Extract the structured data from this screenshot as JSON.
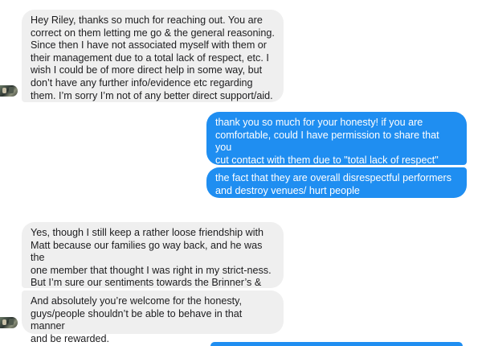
{
  "conversation": {
    "messages": [
      {
        "sender": "contact",
        "text": "Hey Riley, thanks so much for reaching out. You are\ncorrect on them letting me go & the general reasoning.\nSince then I have not associated myself with them or\ntheir management due to a total lack of respect, etc. I\nwish I could be of more direct help in some way, but\ndon’t have any further info/evidence etc regarding\nthem. I’m sorry I’m not of any better direct support/aid."
      },
      {
        "sender": "me",
        "text": "thank you so much for your honesty! if you are\ncomfortable, could I have permission to share that you\ncut contact with them due to \"total lack of respect\"\nbecause that is something"
      },
      {
        "sender": "me",
        "text": "the fact that they are overall disrespectful performers\nand destroy venues/ hurt people"
      },
      {
        "sender": "contact",
        "text": "Yes, though I still keep a rather loose friendship with\nMatt because our families go way back, and he was the\none member that thought I was right in my strict-ness.\nBut I’m sure our sentiments towards the Brinner’s &\nMario fall in a very similar category."
      },
      {
        "sender": "contact",
        "text": "And absolutely you’re welcome for the honesty,\nguys/people shouldn’t be able to behave in that manner\nand be rewarded."
      },
      {
        "sender": "me",
        "text": ""
      }
    ]
  },
  "colors": {
    "incoming_bubble": "#efefef",
    "outgoing_bubble": "#1f8ef1"
  },
  "icons": {
    "avatar": "contact-avatar"
  }
}
